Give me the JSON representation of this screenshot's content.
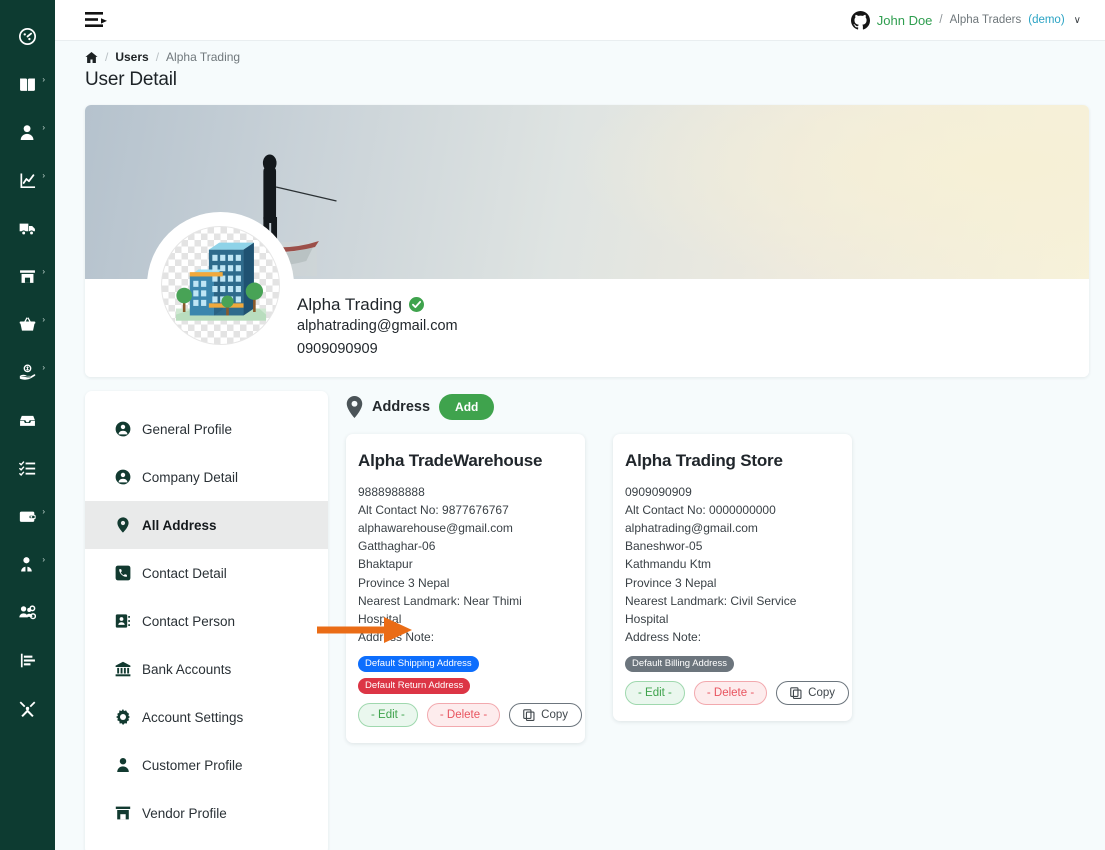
{
  "colors": {
    "rail_bg": "#0d3b31",
    "page_bg": "#f6fbfc",
    "accent_green": "#3fa34d",
    "badge_blue": "#0d6efd",
    "badge_red": "#dc3545",
    "badge_gray": "#6c757d",
    "annotation_orange": "#ea6c16"
  },
  "rail": {
    "items": [
      {
        "name": "dashboard-icon"
      },
      {
        "name": "book-user-icon",
        "caret": "›"
      },
      {
        "name": "user-icon",
        "caret": "›"
      },
      {
        "name": "analytics-icon",
        "caret": "›"
      },
      {
        "name": "delivery-truck-icon"
      },
      {
        "name": "store-icon",
        "caret": "›"
      },
      {
        "name": "basket-icon",
        "caret": "›"
      },
      {
        "name": "hand-money-icon",
        "caret": "›"
      },
      {
        "name": "inbox-icon"
      },
      {
        "name": "task-list-icon"
      },
      {
        "name": "wallet-icon",
        "caret": "›"
      },
      {
        "name": "user-tie-icon",
        "caret": "›"
      },
      {
        "name": "users-gear-icon"
      },
      {
        "name": "report-icon"
      },
      {
        "name": "tools-icon"
      }
    ]
  },
  "topbar": {
    "collapse_icon": "menu-collapse-icon",
    "user": {
      "avatar_icon": "github-icon",
      "name": "John Doe",
      "separator": "/",
      "org": "Alpha Traders",
      "env": "(demo)",
      "caret": "∨"
    }
  },
  "breadcrumb": {
    "home_icon": "home-icon",
    "sep": "/",
    "items": [
      "Users",
      "Alpha Trading"
    ]
  },
  "page": {
    "title": "User Detail"
  },
  "profile": {
    "avatar_icon": "office-building-image",
    "name": "Alpha Trading",
    "verified_icon": "verified-check-icon",
    "email": "alphatrading@gmail.com",
    "phone": "0909090909"
  },
  "tabs": [
    {
      "label": "General Profile",
      "icon": "user-circle-icon",
      "active": false
    },
    {
      "label": "Company Detail",
      "icon": "user-circle-icon",
      "active": false
    },
    {
      "label": "All Address",
      "icon": "map-pin-icon",
      "active": true
    },
    {
      "label": "Contact Detail",
      "icon": "phone-square-icon",
      "active": false
    },
    {
      "label": "Contact Person",
      "icon": "contact-card-icon",
      "active": false
    },
    {
      "label": "Bank Accounts",
      "icon": "bank-icon",
      "active": false
    },
    {
      "label": "Account Settings",
      "icon": "gear-icon",
      "active": false
    },
    {
      "label": "Customer Profile",
      "icon": "person-icon",
      "active": false
    },
    {
      "label": "Vendor Profile",
      "icon": "storefront-icon",
      "active": false
    }
  ],
  "address_section": {
    "icon": "map-pin-icon",
    "title": "Address",
    "add_label": "Add"
  },
  "address_cards": [
    {
      "title": "Alpha TradeWarehouse",
      "phone": "9888988888",
      "alt_contact": "Alt Contact No: 9877676767",
      "email": "alphawarehouse@gmail.com",
      "street": "Gatthaghar-06",
      "city": "Bhaktapur",
      "province": "Province 3 Nepal",
      "landmark": "Nearest Landmark: Near Thimi Hospital",
      "note": "Address Note:",
      "badges": [
        {
          "label": "Default Shipping Address",
          "color": "#0d6efd"
        },
        {
          "label": "Default Return Address",
          "color": "#dc3545"
        }
      ],
      "buttons": {
        "edit": "- Edit -",
        "delete": "- Delete -",
        "copy": "Copy",
        "copy_icon": "copy-icon"
      }
    },
    {
      "title": "Alpha Trading Store",
      "phone": "0909090909",
      "alt_contact": "Alt Contact No: 0000000000",
      "email": "alphatrading@gmail.com",
      "street": "Baneshwor-05",
      "city": "Kathmandu Ktm",
      "province": "Province 3 Nepal",
      "landmark": "Nearest Landmark: Civil Service Hospital",
      "note": "Address Note:",
      "badges": [
        {
          "label": "Default Billing Address",
          "color": "#6c757d"
        }
      ],
      "buttons": {
        "edit": "- Edit -",
        "delete": "- Delete -",
        "copy": "Copy",
        "copy_icon": "copy-icon"
      }
    }
  ],
  "annotation": {
    "type": "arrow",
    "points_to": "delete-button-card-1",
    "color": "#ea6c16"
  }
}
